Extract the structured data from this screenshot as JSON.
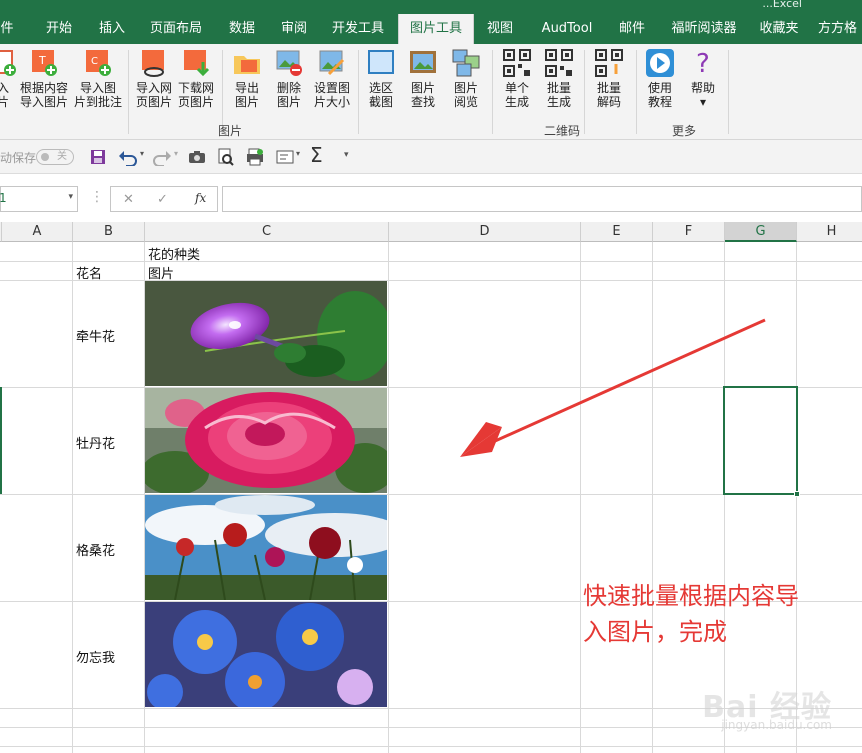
{
  "window": {
    "title_partial": "...Excel"
  },
  "tabs": [
    {
      "label": "件"
    },
    {
      "label": "开始"
    },
    {
      "label": "插入"
    },
    {
      "label": "页面布局"
    },
    {
      "label": "数据"
    },
    {
      "label": "审阅"
    },
    {
      "label": "开发工具"
    },
    {
      "label": "图片工具",
      "active": true
    },
    {
      "label": "视图"
    },
    {
      "label": "AudTool"
    },
    {
      "label": "邮件"
    },
    {
      "label": "福昕阅读器"
    },
    {
      "label": "收藏夹"
    },
    {
      "label": "方方格"
    }
  ],
  "ribbon": {
    "buttons": [
      {
        "label": "入\n片",
        "icon": "import-icon"
      },
      {
        "label": "根据内容\n导入图片",
        "icon": "import-by-content-icon"
      },
      {
        "label": "导入图\n片到批注",
        "icon": "import-to-comment-icon"
      },
      {
        "label": "导入网\n页图片",
        "icon": "web-image-icon"
      },
      {
        "label": "下载网\n页图片",
        "icon": "download-image-icon"
      },
      {
        "label": "导出\n图片",
        "icon": "export-image-icon"
      },
      {
        "label": "删除\n图片",
        "icon": "delete-image-icon"
      },
      {
        "label": "设置图\n片大小",
        "icon": "resize-image-icon"
      },
      {
        "label": "选区\n截图",
        "icon": "screenshot-icon"
      },
      {
        "label": "图片\n查找",
        "icon": "image-search-icon"
      },
      {
        "label": "图片\n阅览",
        "icon": "image-preview-icon"
      },
      {
        "label": "单个\n生成",
        "icon": "qr-single-icon"
      },
      {
        "label": "批量\n生成",
        "icon": "qr-batch-icon"
      },
      {
        "label": "批量\n解码",
        "icon": "qr-decode-icon"
      },
      {
        "label": "使用\n教程",
        "icon": "play-icon"
      },
      {
        "label": "帮助\n▾",
        "icon": "help-icon"
      }
    ],
    "groups": [
      {
        "label": "图片"
      },
      {
        "label": "二维码"
      },
      {
        "label": "更多"
      }
    ]
  },
  "qat": {
    "autosave_label": "动保存",
    "toggle_label": "关"
  },
  "formula_bar": {
    "namebox": "1",
    "cancel": "✕",
    "enter": "✓",
    "fx": "fx",
    "value": ""
  },
  "columns": [
    "A",
    "B",
    "C",
    "D",
    "E",
    "F",
    "G",
    "H"
  ],
  "selected_column": "G",
  "cells": {
    "c1": "花的种类",
    "b2": "花名",
    "c2": "图片"
  },
  "rows": [
    {
      "name": "牵牛花",
      "picture": "morning-glory"
    },
    {
      "name": "牡丹花",
      "picture": "peony"
    },
    {
      "name": "格桑花",
      "picture": "cosmos"
    },
    {
      "name": "勿忘我",
      "picture": "forget-me-not"
    }
  ],
  "annotation": {
    "text": "快速批量根据内容导\n入图片，完成",
    "color": "#e53935"
  },
  "watermark": {
    "text": "Bai 经验",
    "sub": "jingyan.baidu.com"
  },
  "colors": {
    "excel_green": "#217346",
    "arrow_red": "#e53935"
  }
}
